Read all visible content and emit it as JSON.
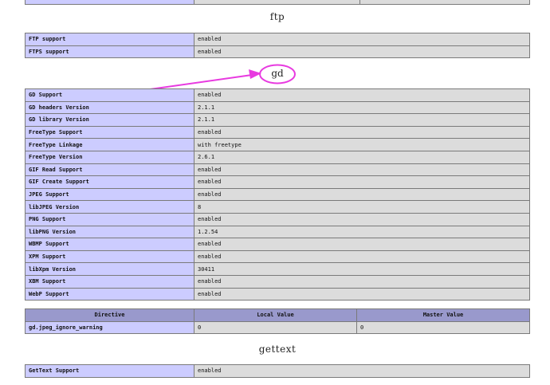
{
  "sections": {
    "ftp": {
      "title": "ftp",
      "rows": [
        {
          "label": "FTP support",
          "value": "enabled"
        },
        {
          "label": "FTPS support",
          "value": "enabled"
        }
      ]
    },
    "gd": {
      "title": "gd",
      "rows": [
        {
          "label": "GD Support",
          "value": "enabled"
        },
        {
          "label": "GD headers Version",
          "value": "2.1.1"
        },
        {
          "label": "GD library Version",
          "value": "2.1.1"
        },
        {
          "label": "FreeType Support",
          "value": "enabled"
        },
        {
          "label": "FreeType Linkage",
          "value": "with freetype"
        },
        {
          "label": "FreeType Version",
          "value": "2.6.1"
        },
        {
          "label": "GIF Read Support",
          "value": "enabled"
        },
        {
          "label": "GIF Create Support",
          "value": "enabled"
        },
        {
          "label": "JPEG Support",
          "value": "enabled"
        },
        {
          "label": "libJPEG Version",
          "value": "8"
        },
        {
          "label": "PNG Support",
          "value": "enabled"
        },
        {
          "label": "libPNG Version",
          "value": "1.2.54"
        },
        {
          "label": "WBMP Support",
          "value": "enabled"
        },
        {
          "label": "XPM Support",
          "value": "enabled"
        },
        {
          "label": "libXpm Version",
          "value": "30411"
        },
        {
          "label": "XBM Support",
          "value": "enabled"
        },
        {
          "label": "WebP Support",
          "value": "enabled"
        }
      ],
      "directives_header": {
        "directive": "Directive",
        "local": "Local Value",
        "master": "Master Value"
      },
      "directives": [
        {
          "name": "gd.jpeg_ignore_warning",
          "local": "0",
          "master": "0"
        }
      ]
    },
    "gettext": {
      "title": "gettext",
      "rows": [
        {
          "label": "GetText Support",
          "value": "enabled"
        }
      ]
    }
  },
  "annotation": {
    "color": "#e83ae0"
  }
}
